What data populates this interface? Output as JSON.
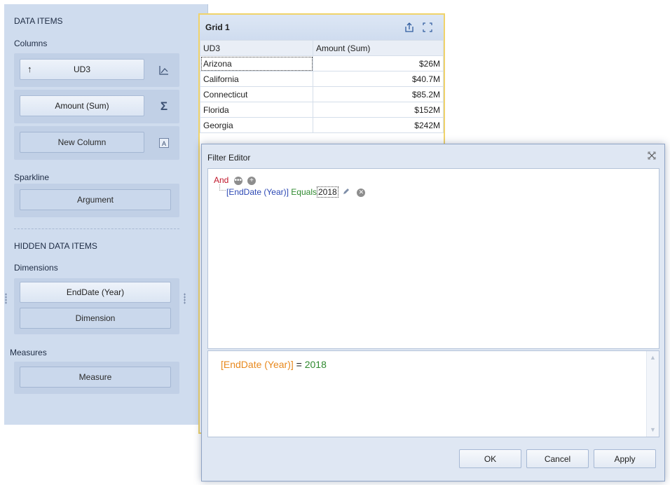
{
  "data_items": {
    "title": "DATA ITEMS",
    "columns_label": "Columns",
    "columns": [
      {
        "label": "UD3",
        "side_icon": "chart-line-icon"
      },
      {
        "label": "Amount (Sum)",
        "side_icon": "sigma-icon"
      },
      {
        "label": "New Column",
        "side_icon": "text-a-icon"
      }
    ],
    "sparkline_label": "Sparkline",
    "sparkline_argument": "Argument",
    "hidden_title": "HIDDEN DATA ITEMS",
    "dimensions_label": "Dimensions",
    "dimensions": [
      "EndDate (Year)",
      "Dimension"
    ],
    "measures_label": "Measures",
    "measures": [
      "Measure"
    ]
  },
  "grid": {
    "title": "Grid 1",
    "headers": [
      "UD3",
      "Amount (Sum)"
    ],
    "rows": [
      [
        "Arizona",
        "$26M"
      ],
      [
        "California",
        "$40.7M"
      ],
      [
        "Connecticut",
        "$85.2M"
      ],
      [
        "Florida",
        "$152M"
      ],
      [
        "Georgia",
        "$242M"
      ]
    ]
  },
  "filter_editor": {
    "title": "Filter Editor",
    "close_glyph": "☒",
    "group_op": "And",
    "condition": {
      "field": "[EndDate (Year)]",
      "operator": "Equals",
      "value": "2018"
    },
    "expression": {
      "field": "[EndDate (Year)]",
      "op": "=",
      "value": "2018"
    },
    "buttons": {
      "ok": "OK",
      "cancel": "Cancel",
      "apply": "Apply"
    }
  },
  "colors": {
    "accent_border": "#f0d36a",
    "panel_bg": "#cfdcee",
    "expr_field": "#e8891e",
    "expr_value": "#2f8a2f"
  }
}
